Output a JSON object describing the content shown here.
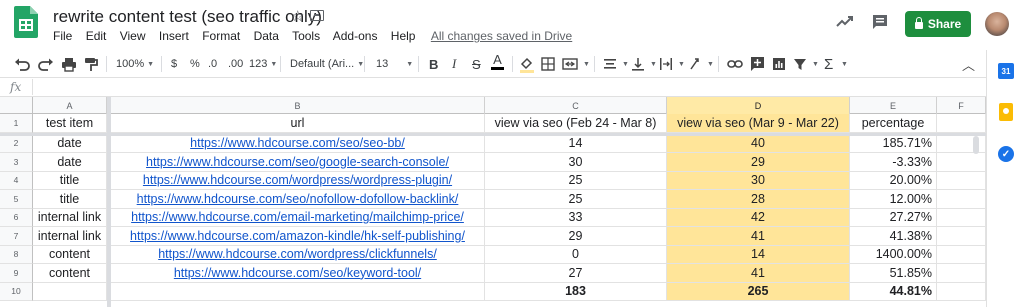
{
  "doc": {
    "title": "rewrite content test (seo traffic only)",
    "save_status": "All changes saved in Drive"
  },
  "menu": [
    "File",
    "Edit",
    "View",
    "Insert",
    "Format",
    "Data",
    "Tools",
    "Add-ons",
    "Help"
  ],
  "share_label": "Share",
  "toolbar": {
    "zoom": "100%",
    "currency": "$",
    "percent": "%",
    "dec_less": ".0",
    "dec_more": ".00",
    "more_formats": "123",
    "font": "Default (Ari...",
    "font_size": "13",
    "bold": "B",
    "italic": "I",
    "strike": "S",
    "text_color": "A"
  },
  "formula": {
    "fx": "fx",
    "value": ""
  },
  "sidebar_calendar_label": "31",
  "columns": [
    "A",
    "B",
    "C",
    "D",
    "E",
    "F"
  ],
  "row_numbers": [
    "1",
    "2",
    "3",
    "4",
    "5",
    "6",
    "7",
    "8",
    "9",
    "10"
  ],
  "headers": {
    "a": "test item",
    "b": "url",
    "c": "view via seo (Feb 24 - Mar 8)",
    "d": "view via seo (Mar 9 - Mar 22)",
    "e": "percentage"
  },
  "rows": [
    {
      "item": "date",
      "url": "https://www.hdcourse.com/seo/seo-bb/",
      "before": "14",
      "after": "40",
      "pct": "185.71%"
    },
    {
      "item": "date",
      "url": "https://www.hdcourse.com/seo/google-search-console/",
      "before": "30",
      "after": "29",
      "pct": "-3.33%"
    },
    {
      "item": "title",
      "url": "https://www.hdcourse.com/wordpress/wordpress-plugin/",
      "before": "25",
      "after": "30",
      "pct": "20.00%"
    },
    {
      "item": "title",
      "url": "https://www.hdcourse.com/seo/nofollow-dofollow-backlink/",
      "before": "25",
      "after": "28",
      "pct": "12.00%"
    },
    {
      "item": "internal link",
      "url": "https://www.hdcourse.com/email-marketing/mailchimp-price/",
      "before": "33",
      "after": "42",
      "pct": "27.27%"
    },
    {
      "item": "internal link",
      "url": "https://www.hdcourse.com/amazon-kindle/hk-self-publishing/",
      "before": "29",
      "after": "41",
      "pct": "41.38%"
    },
    {
      "item": "content",
      "url": "https://www.hdcourse.com/wordpress/clickfunnels/",
      "before": "0",
      "after": "14",
      "pct": "1400.00%"
    },
    {
      "item": "content",
      "url": "https://www.hdcourse.com/seo/keyword-tool/",
      "before": "27",
      "after": "41",
      "pct": "51.85%"
    }
  ],
  "totals": {
    "before": "183",
    "after": "265",
    "pct": "44.81%"
  },
  "colors": {
    "share_green": "#1e8e3e",
    "highlight_yellow": "#ffe599",
    "link_blue": "#1155cc"
  }
}
